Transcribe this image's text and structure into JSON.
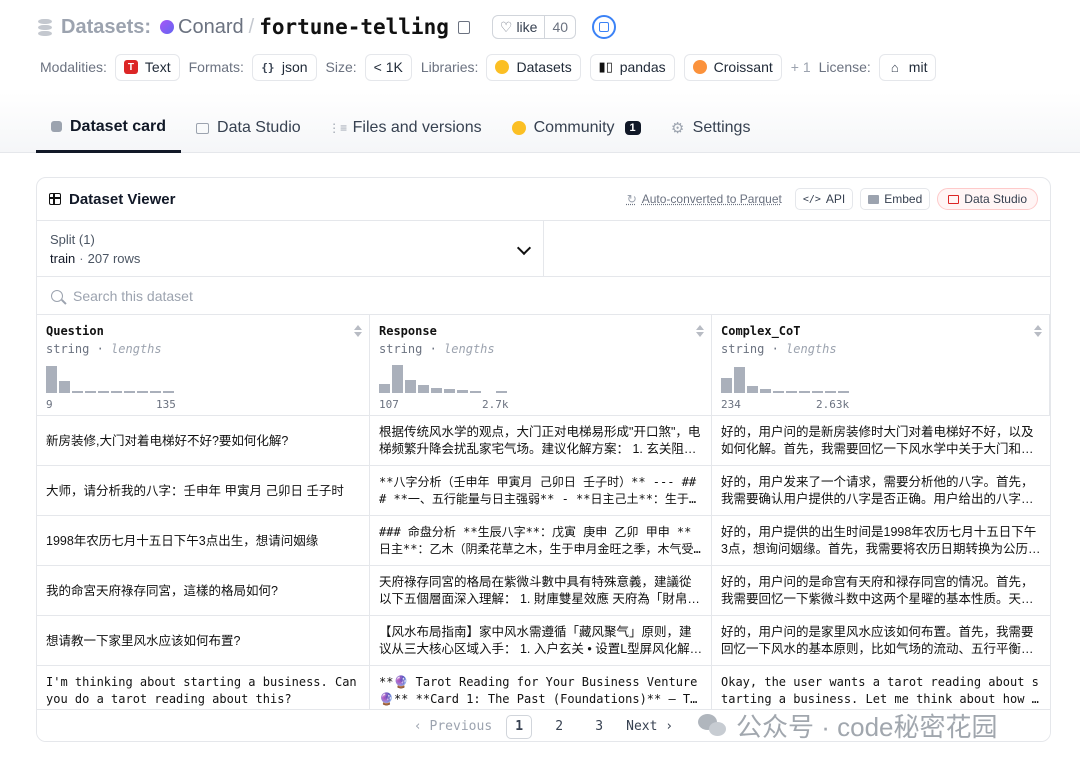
{
  "header": {
    "datasets_label": "Datasets:",
    "org": "Conard",
    "separator": "/",
    "name": "fortune-telling",
    "like_label": "like",
    "like_count": "40"
  },
  "meta": {
    "modalities_label": "Modalities:",
    "modality": "Text",
    "formats_label": "Formats:",
    "format": "json",
    "size_label": "Size:",
    "size": "< 1K",
    "libraries_label": "Libraries:",
    "libraries": [
      "Datasets",
      "pandas",
      "Croissant"
    ],
    "more_libraries": "+ 1",
    "license_label": "License:",
    "license": "mit"
  },
  "tabs": [
    {
      "label": "Dataset card",
      "icon": "card-icon"
    },
    {
      "label": "Data Studio",
      "icon": "grid-icon"
    },
    {
      "label": "Files and versions",
      "icon": "files-icon"
    },
    {
      "label": "Community",
      "icon": "hugging-face-icon",
      "badge": "1"
    },
    {
      "label": "Settings",
      "icon": "gear-icon"
    }
  ],
  "viewer": {
    "title": "Dataset Viewer",
    "auto_converted": "Auto-converted to Parquet",
    "api_label": "API",
    "embed_label": "Embed",
    "studio_label": "Data Studio",
    "split_label": "Split (1)",
    "split_name": "train",
    "split_dot": "·",
    "split_rows": "207 rows",
    "search_placeholder": "Search this dataset"
  },
  "columns": [
    {
      "name": "Question",
      "type": "string",
      "stat": "lengths",
      "min": "9",
      "max": "135",
      "hist": [
        0.9,
        0.4,
        0.08,
        0.08,
        0.05,
        0.05,
        0.05,
        0.05,
        0.05,
        0.05
      ]
    },
    {
      "name": "Response",
      "type": "string",
      "stat": "lengths",
      "min": "107",
      "max": "2.7k",
      "hist": [
        0.3,
        0.92,
        0.42,
        0.25,
        0.18,
        0.12,
        0.1,
        0.05,
        0,
        0.05
      ]
    },
    {
      "name": "Complex_CoT",
      "type": "string",
      "stat": "lengths",
      "min": "234",
      "max": "2.63k",
      "hist": [
        0.5,
        0.88,
        0.22,
        0.12,
        0.08,
        0.05,
        0.05,
        0.05,
        0.05,
        0.05
      ]
    }
  ],
  "rows": [
    {
      "q": "新房装修,大门对着电梯好不好?要如何化解?",
      "r": "根据传统风水学的观点，大门正对电梯易形成\"开口煞\"，电梯频繁升降会扰乱家宅气场。建议化解方案： 1. 玄关阻隔法：在入门处设置玄关柜或屏风",
      "c": "好的，用户问的是新房装修时大门对着电梯好不好，以及如何化解。首先，我需要回忆一下风水学中关于大门和电梯的"
    },
    {
      "q": "大师，请分析我的八字：壬申年 甲寅月 己卯日 壬子时",
      "r": "**八字分析（壬申年 甲寅月 己卯日 壬子时）** --- ### **一、五行能量与日主强弱** - **日主己土**：生于寅月",
      "c": "好的，用户发来了一个请求，需要分析他的八字。首先，我需要确认用户提供的八字是否正确。用户给出的八字是壬申年"
    },
    {
      "q": "1998年农历七月十五日下午3点出生，想请问姻缘",
      "r": "### 命盘分析 **生辰八字**：戊寅 庚申 乙卯 甲申 **日主**：乙木（阴柔花草之木，生于申月金旺之季，木气受制",
      "c": "好的，用户提供的出生时间是1998年农历七月十五日下午3点，想询问姻缘。首先，我需要将农历日期转换为公历，以便"
    },
    {
      "q": "我的命宮天府祿存同宮，這樣的格局如何?",
      "r": "天府祿存同宮的格局在紫微斗數中具有特殊意義，建議從以下五個層面深入理解： 1. 財庫雙星效應 天府為「財帛主」",
      "c": "好的，用户问的是命宫有天府和禄存同宫的情况。首先，我需要回忆一下紫微斗数中这两个星曜的基本性质。天府是南斗"
    },
    {
      "q": "想请教一下家里风水应该如何布置?",
      "r": "【风水布局指南】家中风水需遵循「藏风聚气」原则，建议从三大核心区域入手： 1. 入户玄关 • 设置L型屏风化解穿堂",
      "c": "好的，用户问的是家里风水应该如何布置。首先，我需要回忆一下风水的基本原则，比如气场的流动、五行平衡、方位等"
    },
    {
      "q": "I'm thinking about starting a business. Can you do a tarot reading about this?",
      "r": "**🔮 Tarot Reading for Your Business Venture 🔮** **Card 1: The Past (Foundations)** – The Magician",
      "c": "Okay, the user wants a tarot reading about starting a business. Let me think about how to approach this"
    }
  ],
  "pager": {
    "prev": "‹ Previous",
    "pages": [
      "1",
      "2",
      "3"
    ],
    "next": "Next ›"
  },
  "watermark": "公众号 · code秘密花园"
}
